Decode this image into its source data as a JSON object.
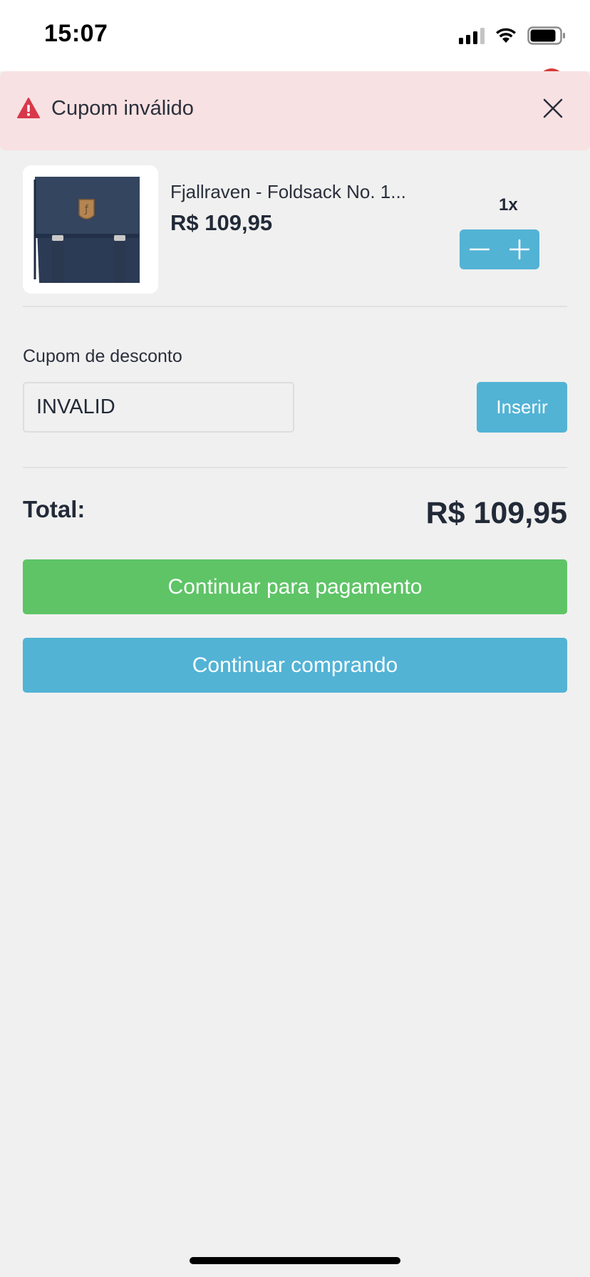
{
  "status_bar": {
    "time": "15:07"
  },
  "toast": {
    "message": "Cupom inválido",
    "icon": "warning-triangle-icon",
    "color": "#d8394a"
  },
  "cart_item": {
    "name": "Fjallraven - Foldsack No. 1...",
    "price": "R$ 109,95",
    "quantity": "1x"
  },
  "coupon": {
    "label": "Cupom de desconto",
    "value": "INVALID",
    "button_label": "Inserir"
  },
  "total": {
    "label": "Total:",
    "value": "R$ 109,95"
  },
  "actions": {
    "pay_label": "Continuar para pagamento",
    "continue_label": "Continuar comprando"
  },
  "colors": {
    "primary": "#52b3d5",
    "success": "#5ec466",
    "toast_bg": "#f8e1e2"
  }
}
